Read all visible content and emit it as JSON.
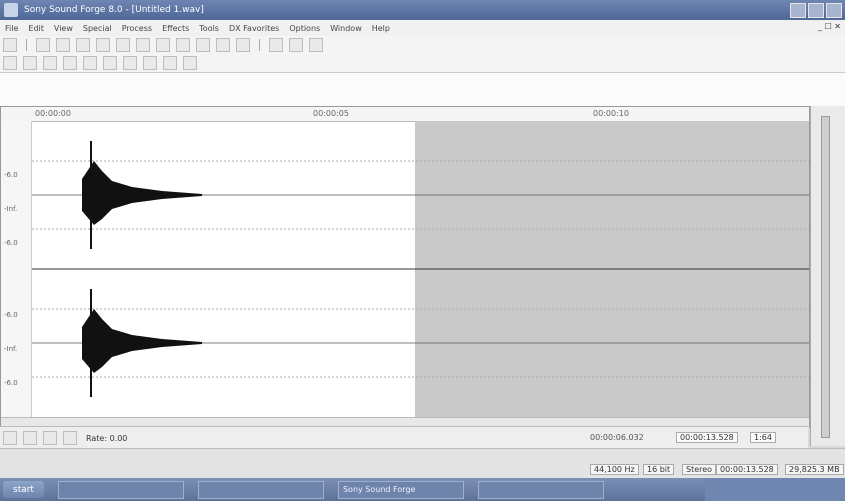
{
  "window": {
    "title": "Sony Sound Forge 8.0 - [Untitled 1.wav]"
  },
  "menu": [
    "File",
    "Edit",
    "View",
    "Special",
    "Process",
    "Effects",
    "Tools",
    "DX Favorites",
    "Options",
    "Window",
    "Help"
  ],
  "menu_right": "_ ☐ ✕",
  "ruler": {
    "ticks": [
      "00:00:00",
      "00:00:05",
      "00:00:10"
    ]
  },
  "db_labels": [
    "-6.0",
    "-Inf.",
    "-6.0",
    "-6.0",
    "-Inf.",
    "-6.0"
  ],
  "transport": {
    "rate_label": "Rate: 0.00",
    "position": "00:00:06.032",
    "cursor": "00:00:13.528",
    "zoom": "1:64"
  },
  "status": {
    "samplerate": "44,100 Hz",
    "bits": "16 bit",
    "channels": "Stereo",
    "length": "00:00:13.528",
    "space": "29,825.3 MB"
  },
  "taskbar": {
    "start": "start",
    "tasks": [
      "",
      "",
      "Sony Sound Forge",
      ""
    ],
    "clock": ""
  },
  "icons": [
    "app-icon",
    "new-icon",
    "open-icon",
    "save-icon",
    "cut-icon",
    "copy-icon",
    "paste-icon",
    "undo-icon",
    "redo-icon",
    "play-icon",
    "stop-icon",
    "record-icon"
  ]
}
